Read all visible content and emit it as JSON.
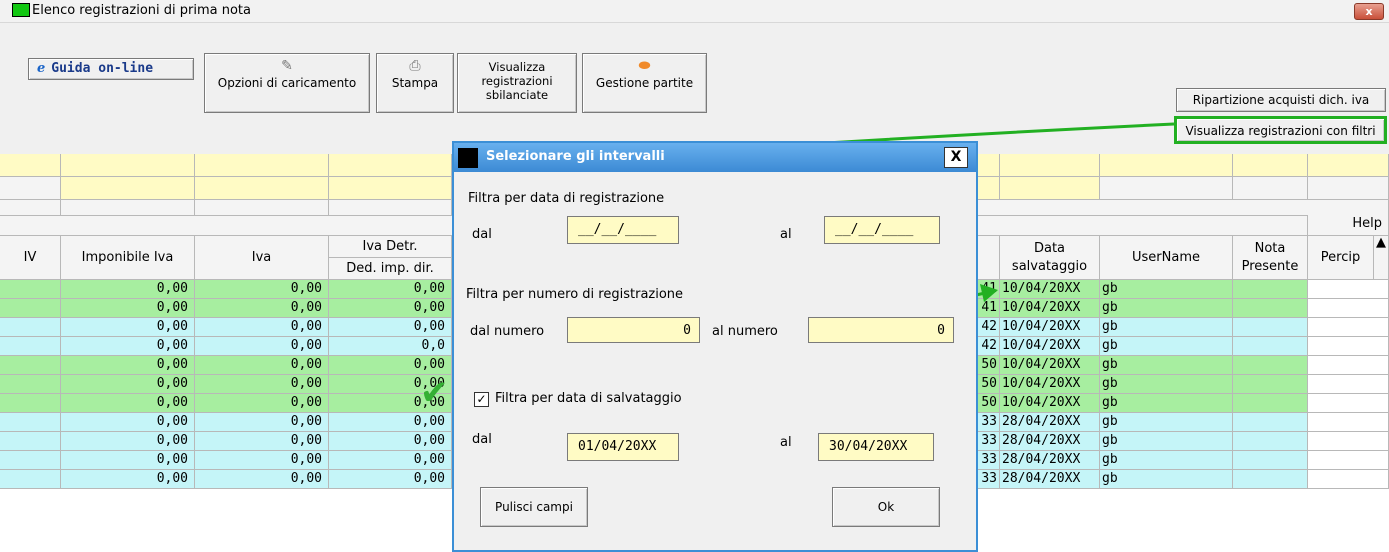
{
  "window": {
    "title": "Elenco registrazioni di prima nota",
    "close_label": "x"
  },
  "toolbar": {
    "guide_label": "Guida on-line",
    "guide_icon": "e",
    "options_label": "Opzioni di caricamento",
    "print_label": "Stampa",
    "unbalanced_label": "Visualizza registrazioni sbilanciate",
    "parts_label": "Gestione partite",
    "ripartizione_label": "Ripartizione acquisti dich. iva",
    "filtri_label": "Visualizza registrazioni con filtri",
    "help_label": "Help"
  },
  "table": {
    "headers": {
      "iv": "IV",
      "imponibile": "Imponibile Iva",
      "iva": "Iva",
      "iva_detr": "Iva Detr.",
      "ded_imp": "Ded. imp. dir.",
      "data_salv": "Data salvataggio",
      "username": "UserName",
      "nota": "Nota Presente",
      "percip": "Percip"
    },
    "rows": [
      {
        "imp": "0,00",
        "iva": "0,00",
        "ded": "0,00",
        "reg": "41",
        "date": "10/04/20XX",
        "user": "gb",
        "color": "green"
      },
      {
        "imp": "0,00",
        "iva": "0,00",
        "ded": "0,00",
        "reg": "41",
        "date": "10/04/20XX",
        "user": "gb",
        "color": "green"
      },
      {
        "imp": "0,00",
        "iva": "0,00",
        "ded": "0,00",
        "reg": "42",
        "date": "10/04/20XX",
        "user": "gb",
        "color": "cyan"
      },
      {
        "imp": "0,00",
        "iva": "0,00",
        "ded": "0,0",
        "reg": "42",
        "date": "10/04/20XX",
        "user": "gb",
        "color": "cyan"
      },
      {
        "imp": "0,00",
        "iva": "0,00",
        "ded": "0,00",
        "reg": "50",
        "date": "10/04/20XX",
        "user": "gb",
        "color": "green"
      },
      {
        "imp": "0,00",
        "iva": "0,00",
        "ded": "0,00",
        "reg": "50",
        "date": "10/04/20XX",
        "user": "gb",
        "color": "green"
      },
      {
        "imp": "0,00",
        "iva": "0,00",
        "ded": "0,00",
        "reg": "50",
        "date": "10/04/20XX",
        "user": "gb",
        "color": "green"
      },
      {
        "imp": "0,00",
        "iva": "0,00",
        "ded": "0,00",
        "reg": "33",
        "date": "28/04/20XX",
        "user": "gb",
        "color": "cyan"
      },
      {
        "imp": "0,00",
        "iva": "0,00",
        "ded": "0,00",
        "reg": "33",
        "date": "28/04/20XX",
        "user": "gb",
        "color": "cyan"
      },
      {
        "imp": "0,00",
        "iva": "0,00",
        "ded": "0,00",
        "reg": "33",
        "date": "28/04/20XX",
        "user": "gb",
        "color": "cyan"
      },
      {
        "imp": "0,00",
        "iva": "0,00",
        "ded": "0,00",
        "reg": "33",
        "date": "28/04/20XX",
        "user": "gb",
        "color": "cyan"
      }
    ]
  },
  "dialog": {
    "title": "Selezionare gli intervalli",
    "close_label": "X",
    "sec1": "Filtra per data di registrazione",
    "dal": "dal",
    "al": "al",
    "date_from_empty": "__/__/____",
    "date_to_empty": "__/__/____",
    "sec2": "Filtra per numero di registrazione",
    "dal_numero": "dal numero",
    "al_numero": "al numero",
    "num_from": "0",
    "num_to": "0",
    "sec3": "Filtra per data di salvataggio",
    "sec3_checked": true,
    "save_from": "01/04/20XX",
    "save_to": "30/04/20XX",
    "clear_label": "Pulisci campi",
    "ok_label": "Ok"
  },
  "colors": {
    "row_green": "#a7eea0",
    "row_cyan": "#c5f5f8",
    "filter_yellow": "#fffbc5",
    "annotation": "#22b022",
    "dialog_title": "#3c8ad4"
  }
}
